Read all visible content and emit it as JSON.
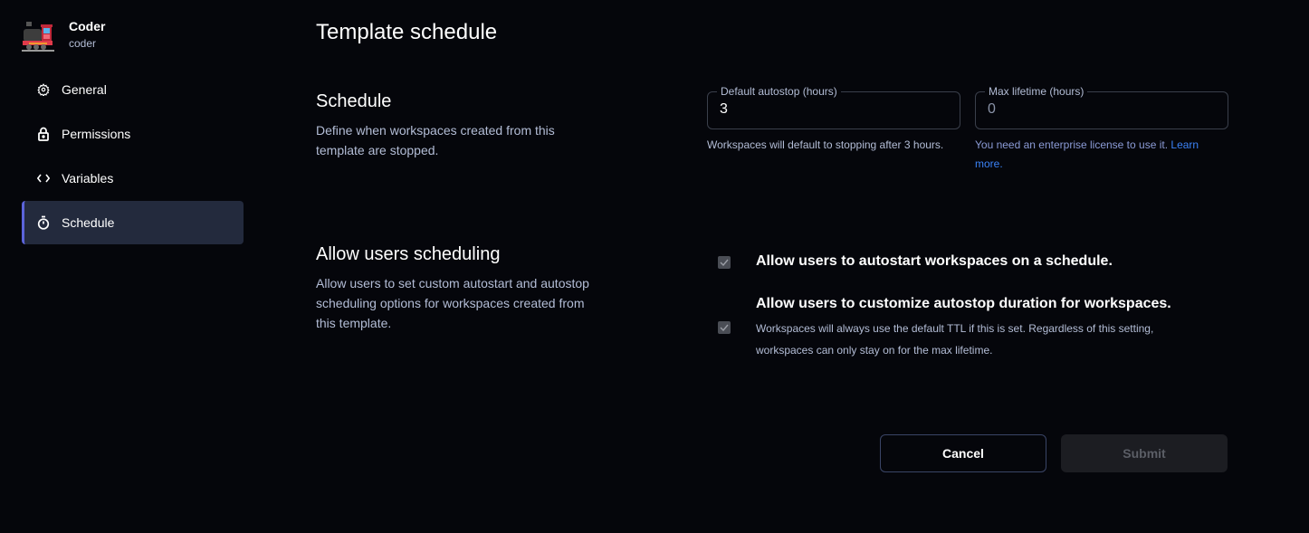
{
  "org": {
    "name": "Coder",
    "slug": "coder",
    "logo": "locomotive-icon"
  },
  "sidebar": {
    "items": [
      {
        "label": "General",
        "icon": "gear-icon"
      },
      {
        "label": "Permissions",
        "icon": "lock-icon"
      },
      {
        "label": "Variables",
        "icon": "code-icon"
      },
      {
        "label": "Schedule",
        "icon": "timer-icon",
        "active": true
      }
    ]
  },
  "page": {
    "title": "Template schedule"
  },
  "schedule": {
    "title": "Schedule",
    "description": "Define when workspaces created from this template are stopped.",
    "default_autostop": {
      "label": "Default autostop (hours)",
      "value": "3",
      "help": "Workspaces will default to stopping after 3 hours."
    },
    "max_lifetime": {
      "label": "Max lifetime (hours)",
      "value": "0",
      "help": "You need an enterprise license to use it.",
      "link": "Learn more."
    }
  },
  "scheduling": {
    "title": "Allow users scheduling",
    "description": "Allow users to set custom autostart and autostop scheduling options for workspaces created from this template.",
    "autostart": {
      "label": "Allow users to autostart workspaces on a schedule.",
      "checked": true
    },
    "autostop": {
      "label": "Allow users to customize autostop duration for workspaces.",
      "help": "Workspaces will always use the default TTL if this is set. Regardless of this setting, workspaces can only stay on for the max lifetime.",
      "checked": true
    }
  },
  "actions": {
    "cancel": "Cancel",
    "submit": "Submit"
  },
  "colors": {
    "background": "#05060b",
    "active_nav": "#232a3d",
    "accent": "#5b63d9",
    "link": "#3b82f6"
  }
}
